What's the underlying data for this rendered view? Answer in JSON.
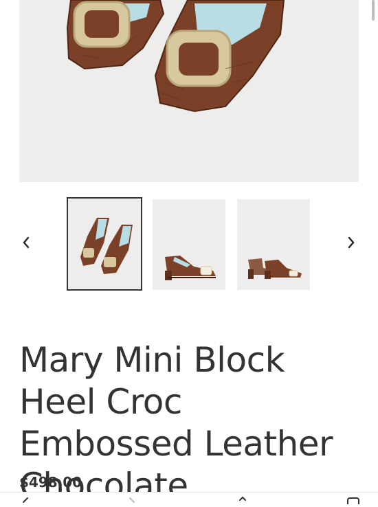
{
  "product": {
    "title": "Mary Mini Block Heel Croc Embossed Leather Chocolate",
    "price": "$498.00"
  },
  "gallery": {
    "prev_icon": "chevron-left-icon",
    "next_icon": "chevron-right-icon",
    "selected_index": 0,
    "thumbnail_count": 3
  },
  "colors": {
    "leather": "#7a4128",
    "leather_dark": "#4e2616",
    "lining": "#b9dde4",
    "buckle": "#d8c8a0",
    "background": "#efedeb",
    "text": "#333333"
  }
}
